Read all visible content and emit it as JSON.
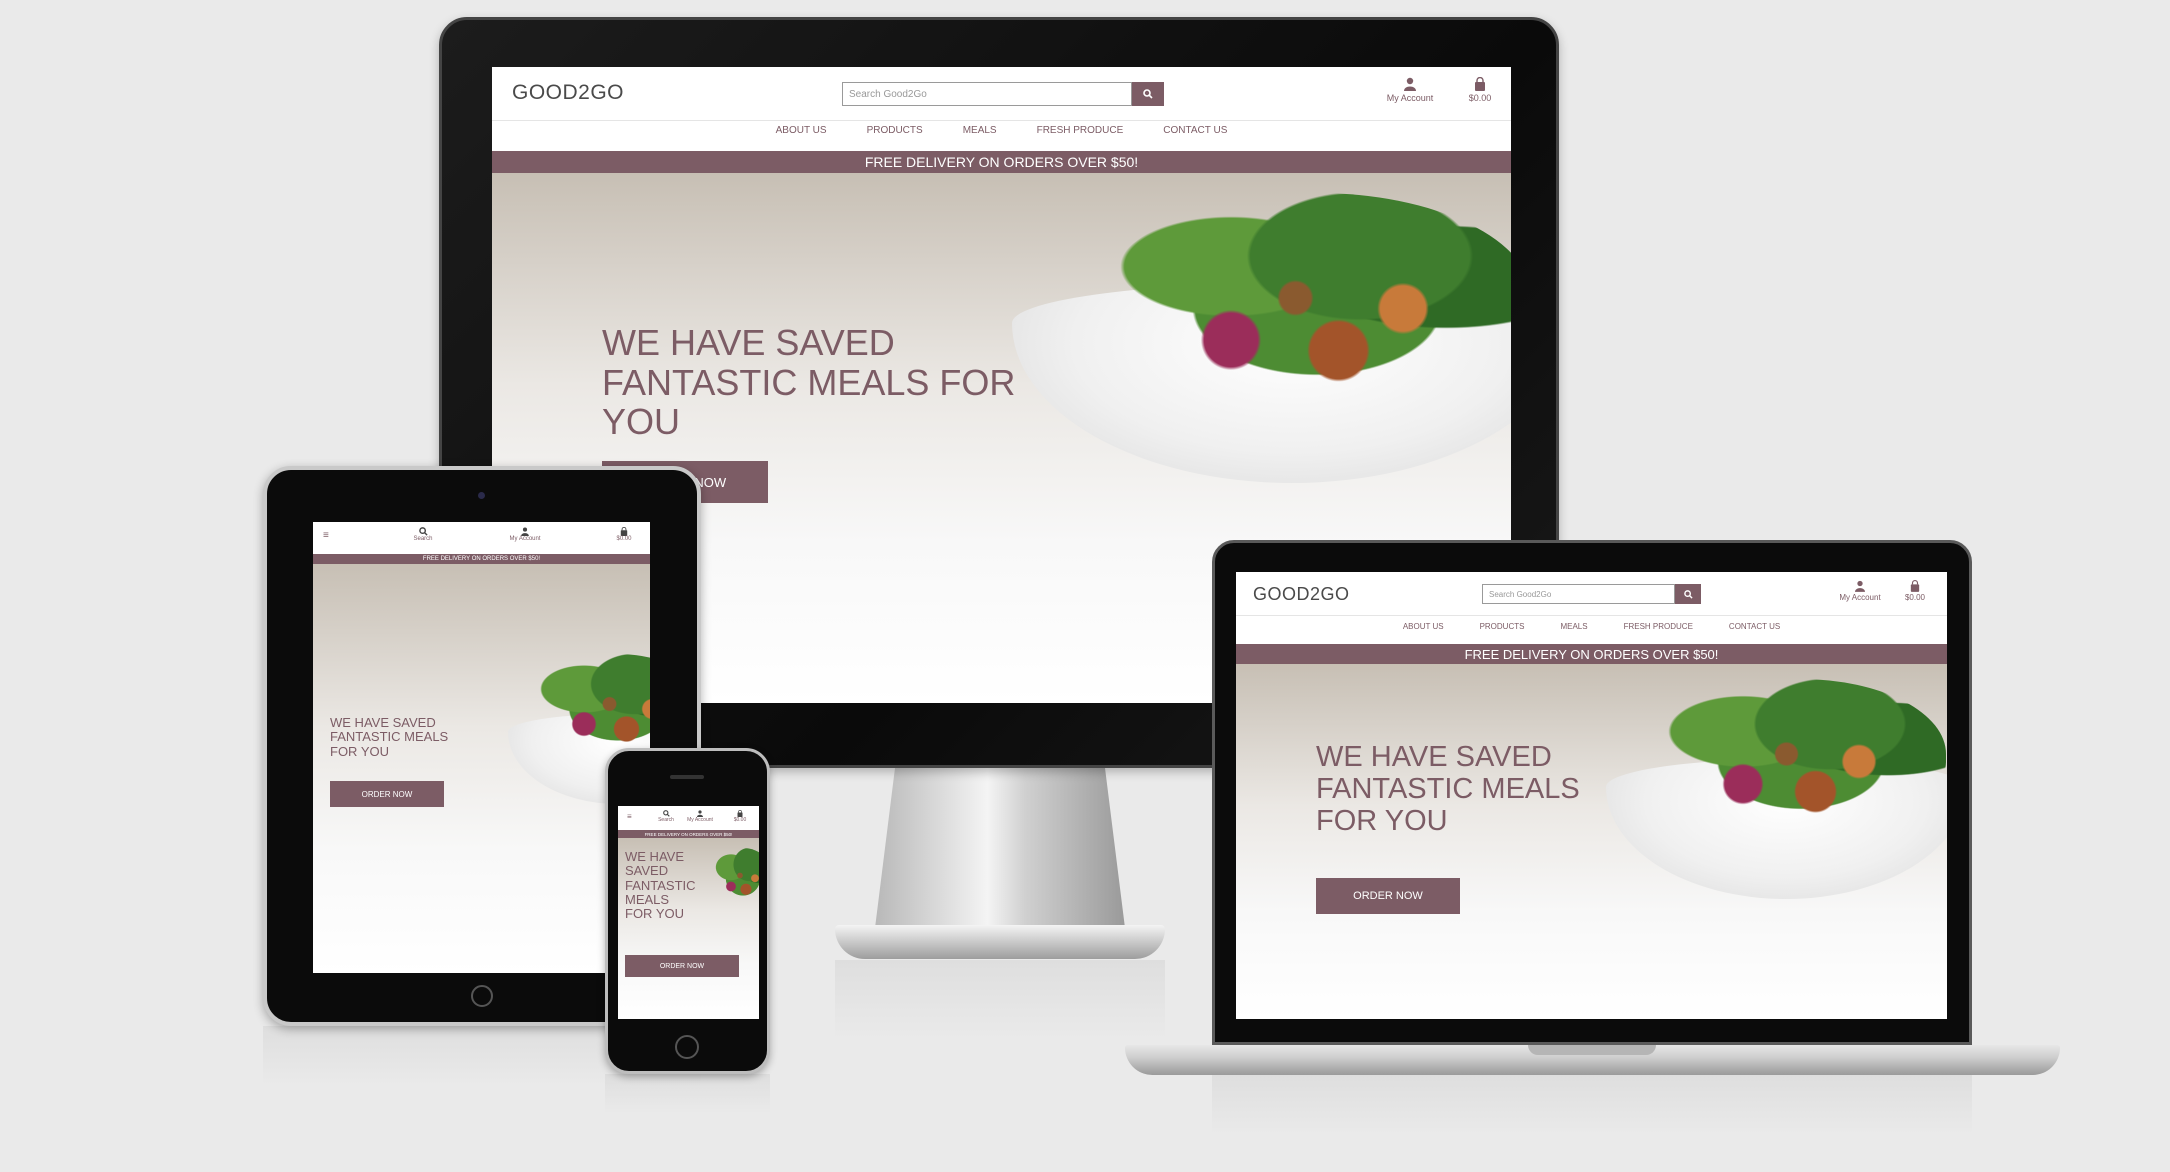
{
  "site": {
    "logo": "GOOD2GO",
    "search_placeholder": "Search Good2Go",
    "account_label": "My Account",
    "cart_total": "$0.00",
    "search_label": "Search",
    "nav": [
      "ABOUT US",
      "PRODUCTS",
      "MEALS",
      "FRESH PRODUCE",
      "CONTACT US"
    ],
    "banner": "FREE DELIVERY ON ORDERS OVER $50!",
    "hero_title_lines": [
      "WE HAVE SAVED",
      "FANTASTIC MEALS FOR",
      "YOU"
    ],
    "hero_title_lines_laptop": [
      "WE HAVE SAVED",
      "FANTASTIC MEALS",
      "FOR YOU"
    ],
    "hero_title_lines_tablet": [
      "WE HAVE SAVED",
      "FANTASTIC MEALS",
      "FOR YOU"
    ],
    "hero_title_lines_phone": [
      "WE HAVE",
      "SAVED",
      "FANTASTIC",
      "MEALS",
      "FOR YOU"
    ],
    "hero_button": "ORDER NOW",
    "hero_button_partial": "NOW"
  },
  "icons": {
    "search": "search-icon",
    "account": "user-icon",
    "cart": "shopping-bag-icon",
    "menu": "hamburger-menu-icon"
  },
  "colors": {
    "brand": "#7c5c65",
    "background": "#eaeaea"
  }
}
